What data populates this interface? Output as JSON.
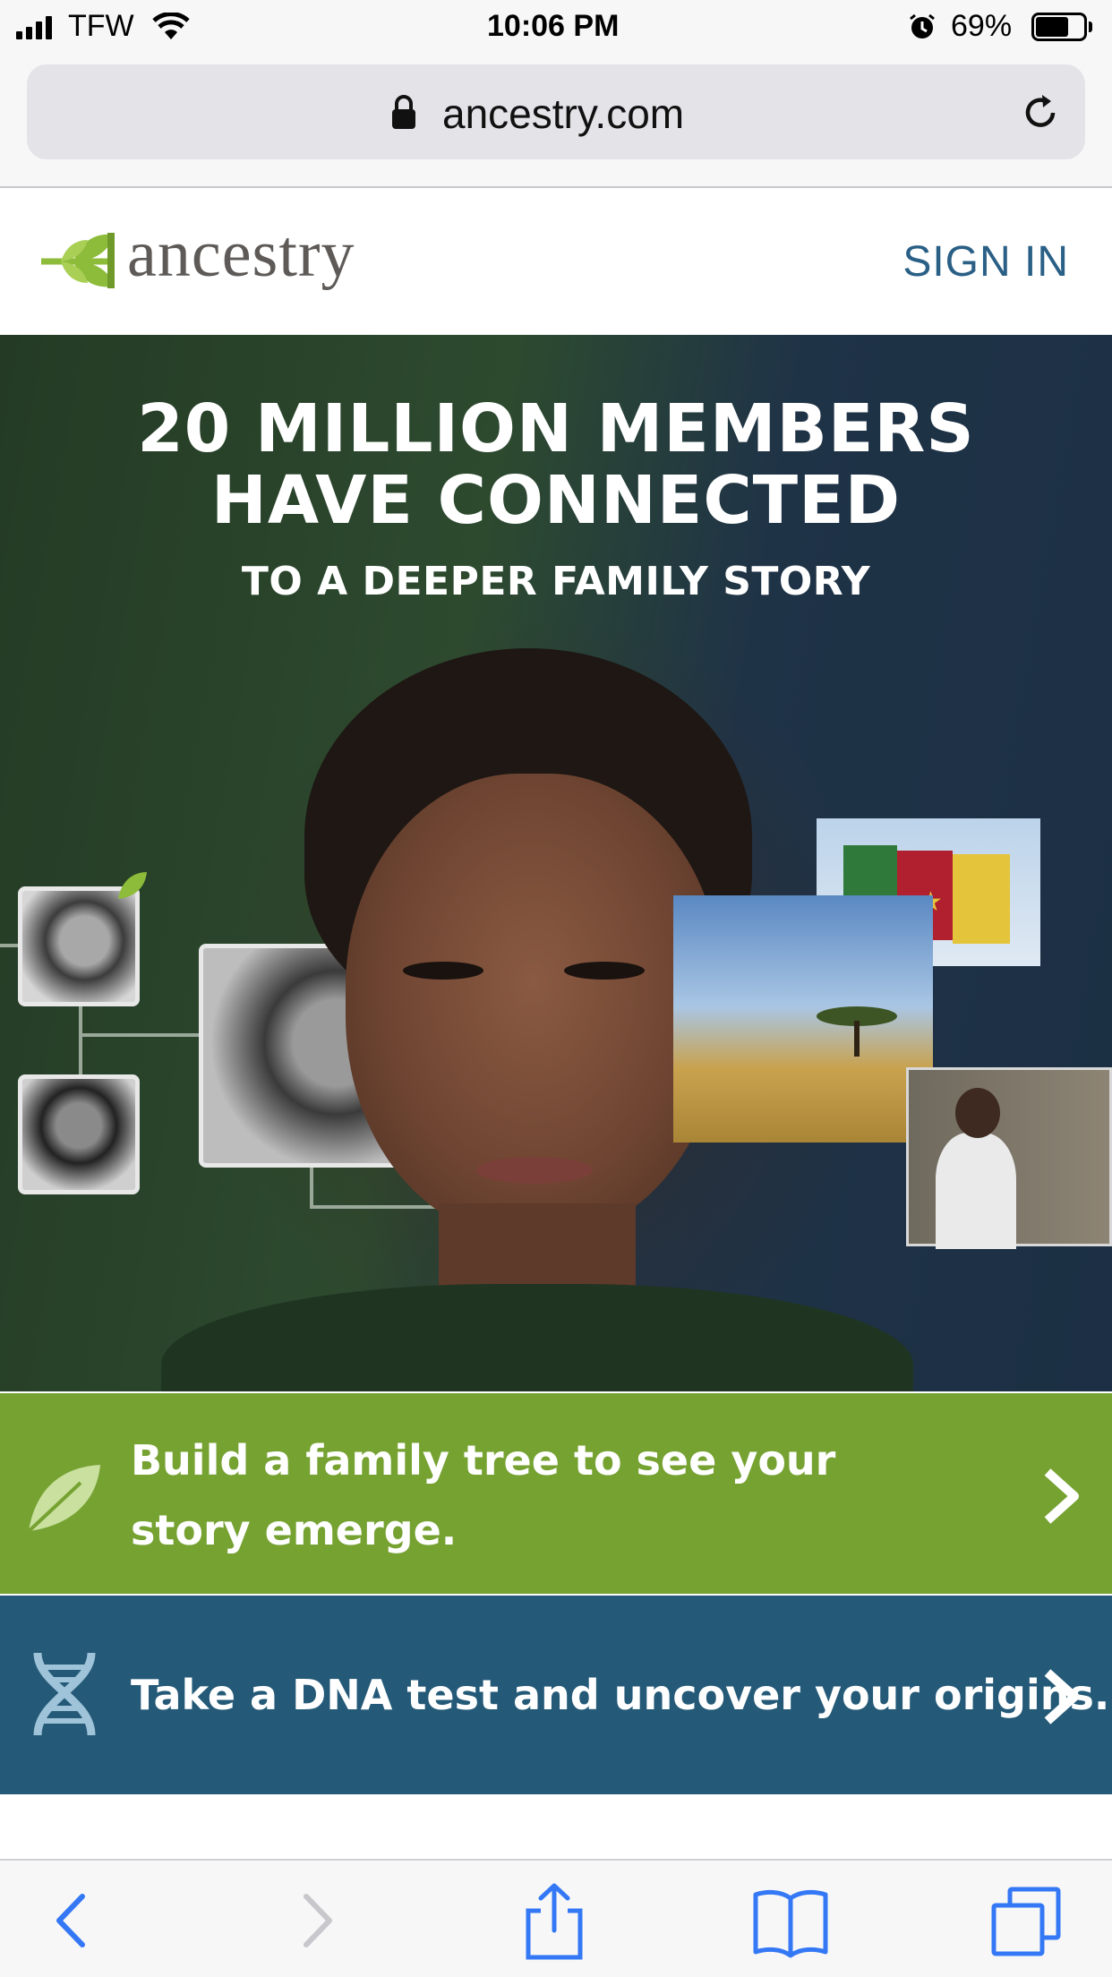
{
  "status_bar": {
    "carrier": "TFW",
    "time": "10:06 PM",
    "battery_percent": "69%",
    "battery_level": 0.69,
    "icons": [
      "signal-icon",
      "wifi-icon",
      "alarm-icon",
      "battery-icon"
    ]
  },
  "browser": {
    "url": "ancestry.com",
    "icons": [
      "lock-icon",
      "reload-icon"
    ]
  },
  "site_header": {
    "logo_text": "ancestry",
    "sign_in_label": "SIGN IN"
  },
  "hero": {
    "headline_line1": "20 MILLION MEMBERS",
    "headline_line2": "HAVE CONNECTED",
    "subheadline": "TO A DEEPER FAMILY STORY"
  },
  "cta": [
    {
      "line1": "Build a family tree to see your",
      "line2": "story emerge.",
      "icon": "leaf-icon"
    },
    {
      "line1": "Take a DNA test and uncover your origins.",
      "icon": "dna-icon"
    }
  ],
  "toolbar": {
    "icons": [
      "back-icon",
      "forward-icon",
      "share-icon",
      "bookmarks-icon",
      "tabs-icon"
    ]
  },
  "colors": {
    "brand_green": "#76a232",
    "brand_blue": "#245a78",
    "signin_blue": "#2a5f86",
    "ios_blue": "#3478f6"
  }
}
